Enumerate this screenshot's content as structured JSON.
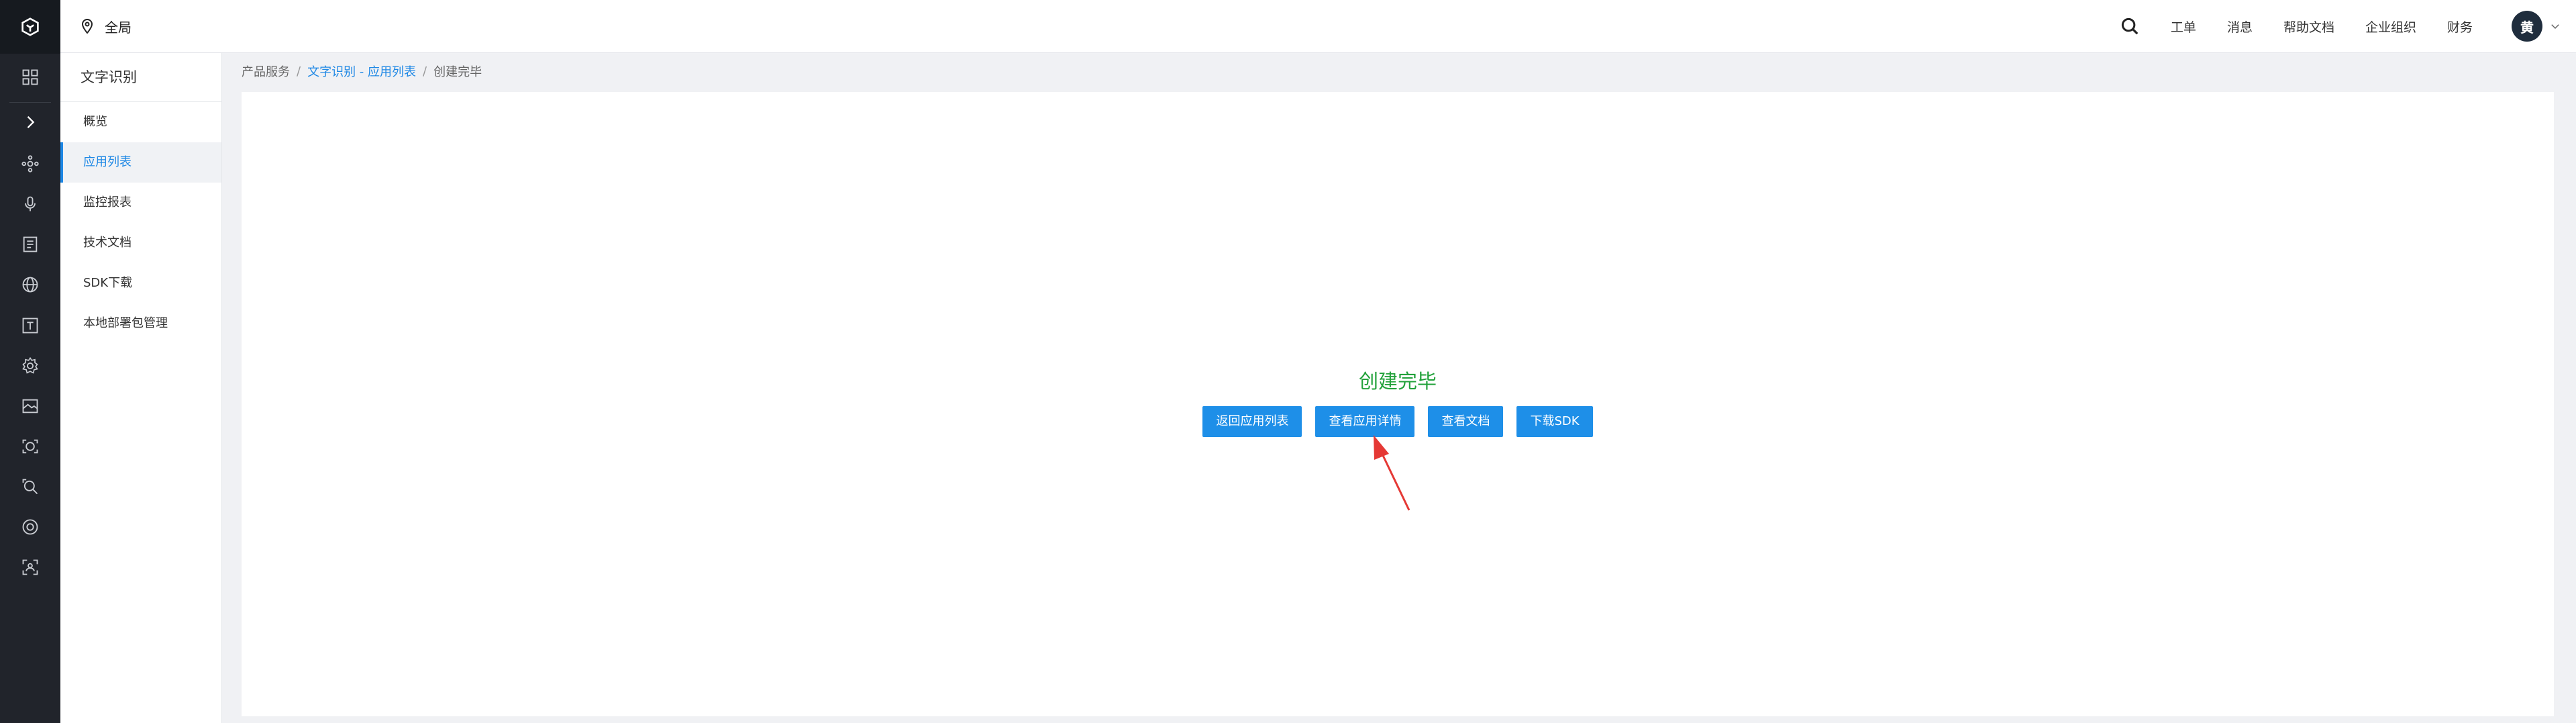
{
  "app": {
    "region_label": "全局"
  },
  "topnav": {
    "items": [
      "工单",
      "消息",
      "帮助文档",
      "企业组织",
      "财务"
    ],
    "avatar": "黄"
  },
  "rail": {
    "icons": [
      "logo-icon",
      "dashboard-icon",
      "expand-icon",
      "network-icon",
      "microphone-icon",
      "document-scan-icon",
      "globe-icon",
      "text-icon",
      "settings-icon",
      "image-icon",
      "face-icon",
      "search-image-icon",
      "target-icon",
      "scan-icon"
    ]
  },
  "submenu": {
    "title": "文字识别",
    "items": [
      "概览",
      "应用列表",
      "监控报表",
      "技术文档",
      "SDK下载",
      "本地部署包管理"
    ],
    "active_index": 1
  },
  "breadcrumb": {
    "root": "产品服务",
    "middle": "文字识别 - 应用列表",
    "current": "创建完毕"
  },
  "main": {
    "status_text": "创建完毕",
    "buttons": [
      "返回应用列表",
      "查看应用详情",
      "查看文档",
      "下载SDK"
    ]
  },
  "colors": {
    "accent": "#1e8fe8",
    "success": "#21a13a",
    "annotation_arrow": "#e53935"
  }
}
